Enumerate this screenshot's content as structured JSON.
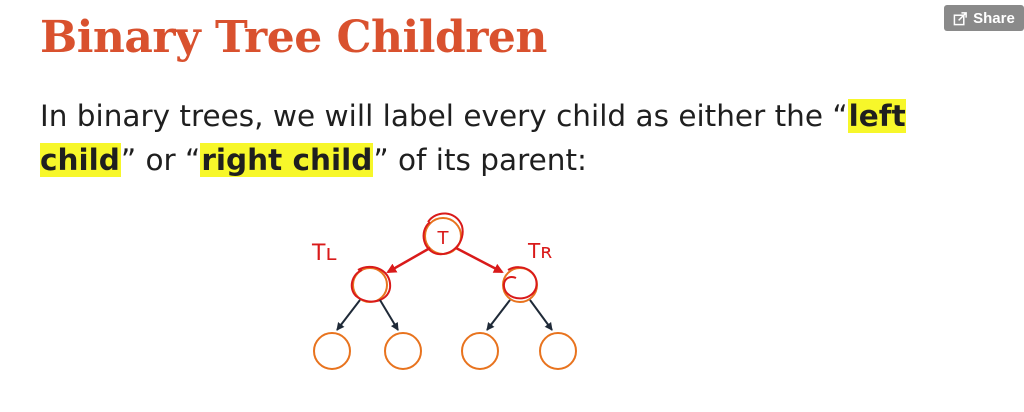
{
  "slide": {
    "title": "Binary Tree Children",
    "text_before": "In binary trees, we will label every child as either the “",
    "highlight_left": "left child",
    "text_between": "” or “",
    "highlight_right": "right child",
    "text_after": "” of its parent:"
  },
  "share_button": {
    "label": "Share",
    "icon": "share-icon"
  },
  "diagram": {
    "root_label": "T",
    "left_annotation": "Tʟ",
    "right_annotation": "Tʀ",
    "node_color": "#e8731e",
    "ink_color": "#d91a1a",
    "edge_color": "#1f2a38"
  }
}
